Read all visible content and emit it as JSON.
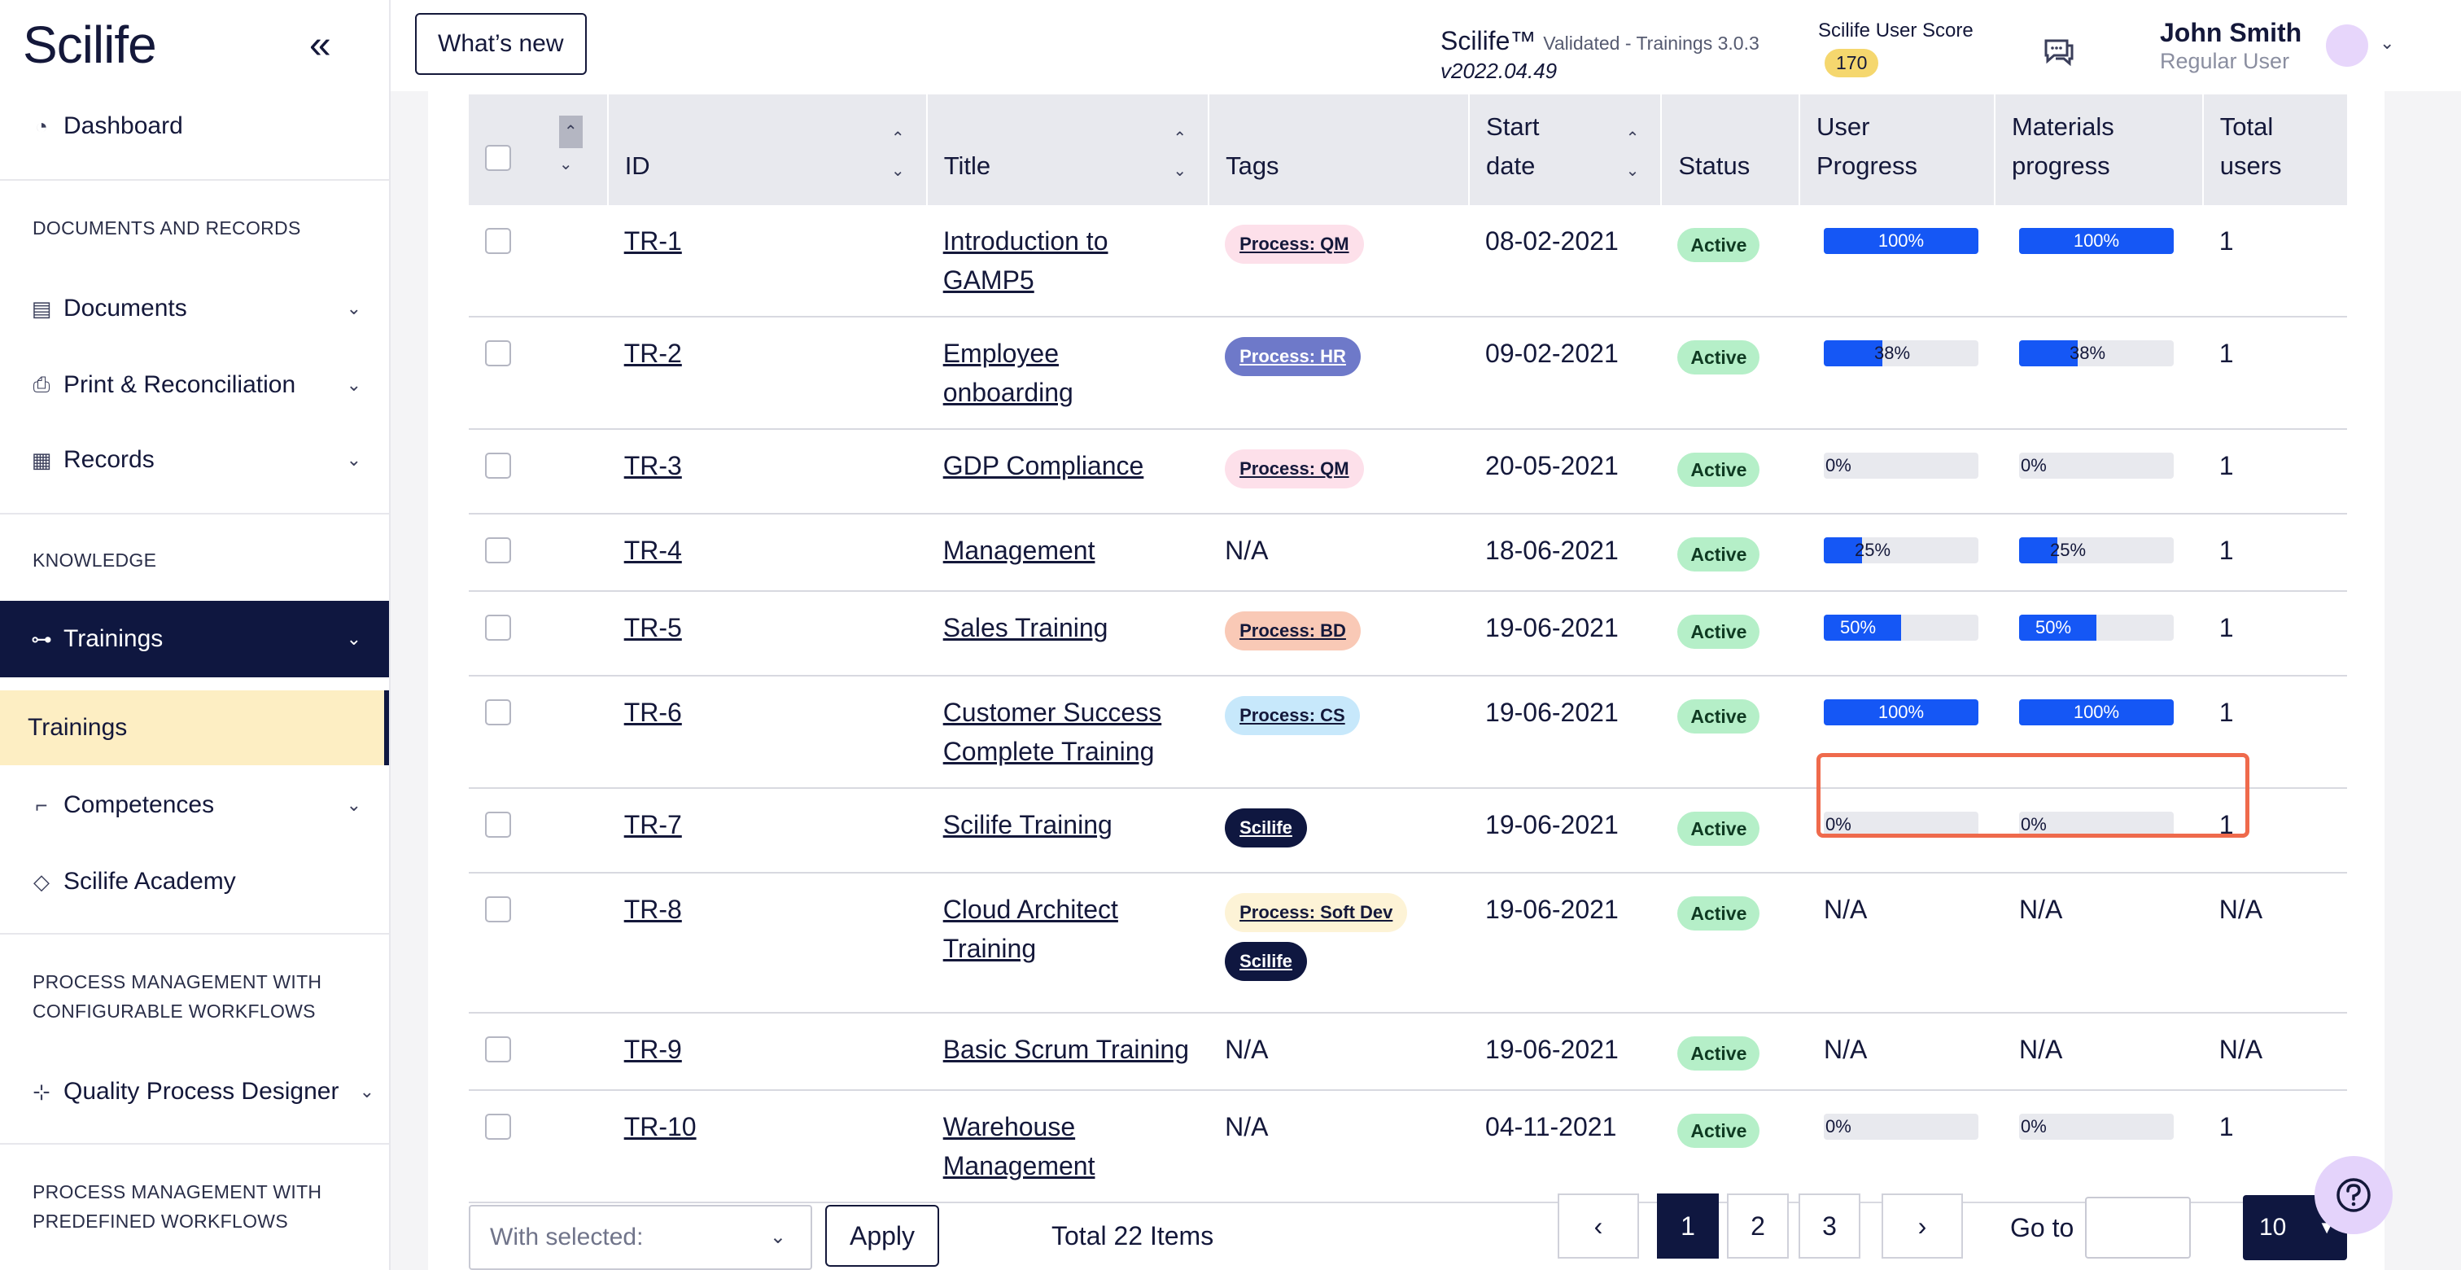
{
  "sidebar": {
    "logo": "Scilife",
    "items": {
      "dashboard": "Dashboard",
      "documents": "Documents",
      "print": "Print & Reconciliation",
      "records": "Records",
      "trainings": "Trainings",
      "trainings_sub": "Trainings",
      "competences": "Competences",
      "academy": "Scilife Academy",
      "qpd": "Quality Process Designer"
    },
    "sections": {
      "docs": "DOCUMENTS AND RECORDS",
      "knowledge": "KNOWLEDGE",
      "pm_config_1": "PROCESS MANAGEMENT WITH",
      "pm_config_2": "CONFIGURABLE WORKFLOWS",
      "pm_pre_1": "PROCESS MANAGEMENT WITH",
      "pm_pre_2": "PREDEFINED WORKFLOWS"
    }
  },
  "header": {
    "whats_new": "What’s new",
    "product": "Scilife™",
    "product_sub": "Validated - Trainings 3.0.3",
    "version": "v2022.04.49",
    "score_label": "Scilife User Score",
    "score": "170",
    "user_name": "John Smith",
    "user_role": "Regular User"
  },
  "table": {
    "headers": {
      "id": "ID",
      "title": "Title",
      "tags": "Tags",
      "start1": "Start",
      "start2": "date",
      "status": "Status",
      "up1": "User",
      "up2": "Progress",
      "mp1": "Materials",
      "mp2": "progress",
      "tu1": "Total",
      "tu2": "users"
    },
    "rows": [
      {
        "id": "TR-1",
        "title1": "Introduction to",
        "title2": "GAMP5",
        "tags": [
          "Process: QM"
        ],
        "start": "08-02-2021",
        "status": "Active",
        "user": "100%",
        "user_val": 100,
        "mat": "100%",
        "mat_val": 100,
        "total": "1"
      },
      {
        "id": "TR-2",
        "title1": "Employee",
        "title2": "onboarding",
        "tags": [
          "Process: HR"
        ],
        "start": "09-02-2021",
        "status": "Active",
        "user": "38%",
        "user_val": 38,
        "mat": "38%",
        "mat_val": 38,
        "total": "1"
      },
      {
        "id": "TR-3",
        "title1": "GDP Compliance",
        "title2": "",
        "tags": [
          "Process: QM"
        ],
        "start": "20-05-2021",
        "status": "Active",
        "user": "0%",
        "user_val": 0,
        "mat": "0%",
        "mat_val": 0,
        "total": "1"
      },
      {
        "id": "TR-4",
        "title1": "Management",
        "title2": "",
        "tags_na": "N/A",
        "start": "18-06-2021",
        "status": "Active",
        "user": "25%",
        "user_val": 25,
        "mat": "25%",
        "mat_val": 25,
        "total": "1"
      },
      {
        "id": "TR-5",
        "title1": "Sales Training",
        "title2": "",
        "tags": [
          "Process: BD"
        ],
        "start": "19-06-2021",
        "status": "Active",
        "user": "50%",
        "user_val": 50,
        "mat": "50%",
        "mat_val": 50,
        "total": "1"
      },
      {
        "id": "TR-6",
        "title1": "Customer Success",
        "title2": "Complete Training",
        "tags": [
          "Process: CS"
        ],
        "start": "19-06-2021",
        "status": "Active",
        "user": "100%",
        "user_val": 100,
        "mat": "100%",
        "mat_val": 100,
        "total": "1"
      },
      {
        "id": "TR-7",
        "title1": "Scilife Training",
        "title2": "",
        "tags": [
          "Scilife"
        ],
        "start": "19-06-2021",
        "status": "Active",
        "user": "0%",
        "user_val": 0,
        "mat": "0%",
        "mat_val": 0,
        "total": "1"
      },
      {
        "id": "TR-8",
        "title1": "Cloud Architect",
        "title2": "Training",
        "tags": [
          "Process: Soft Dev",
          "Scilife"
        ],
        "start": "19-06-2021",
        "status": "Active",
        "user_na": "N/A",
        "mat_na": "N/A",
        "total": "N/A"
      },
      {
        "id": "TR-9",
        "title1": "Basic Scrum Training",
        "title2": "",
        "tags_na": "N/A",
        "start": "19-06-2021",
        "status": "Active",
        "user_na": "N/A",
        "mat_na": "N/A",
        "total": "N/A"
      },
      {
        "id": "TR-10",
        "title1": "Warehouse",
        "title2": "Management",
        "tags_na": "N/A",
        "start": "04-11-2021",
        "status": "Active",
        "user": "0%",
        "user_val": 0,
        "mat": "0%",
        "mat_val": 0,
        "total": "1"
      }
    ]
  },
  "colors": {
    "navy": "#0f1740",
    "progress": "#1557f5",
    "tag_qm": "#fde0ea",
    "tag_hr": "#6e79c9",
    "tag_bd": "#f9c9b6",
    "tag_cs": "#c7e8fb",
    "tag_softdev": "#fdf3d6",
    "tag_scilife": "#0f1740",
    "highlight": "#ef6a4c"
  },
  "footer": {
    "with_selected": "With selected:",
    "apply": "Apply",
    "total": "Total 22 Items",
    "pages": [
      "1",
      "2",
      "3"
    ],
    "prev": "‹",
    "next": "›",
    "goto": "Go to",
    "per_page": "10"
  }
}
